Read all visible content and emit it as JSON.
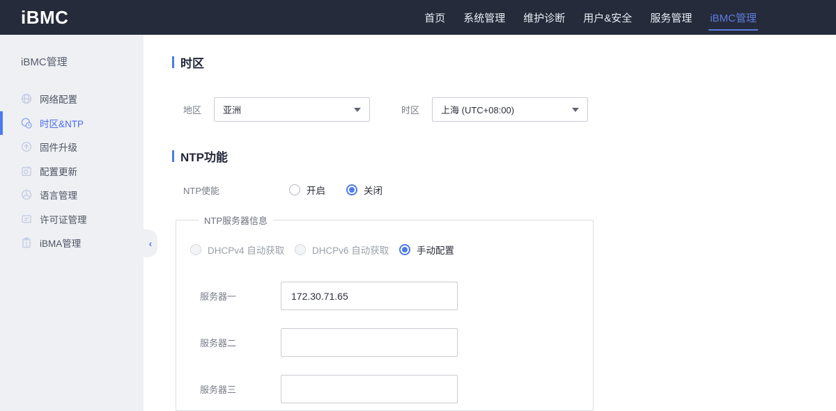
{
  "accent": "#4c7af0",
  "header": {
    "logo": "iBMC",
    "nav": [
      {
        "label": "首页",
        "active": false
      },
      {
        "label": "系统管理",
        "active": false
      },
      {
        "label": "维护诊断",
        "active": false
      },
      {
        "label": "用户&安全",
        "active": false
      },
      {
        "label": "服务管理",
        "active": false
      },
      {
        "label": "iBMC管理",
        "active": true
      }
    ]
  },
  "sidebar": {
    "title": "iBMC管理",
    "items": [
      {
        "label": "网络配置",
        "icon": "globe-icon",
        "active": false
      },
      {
        "label": "时区&NTP",
        "icon": "timezone-clock-icon",
        "active": true
      },
      {
        "label": "固件升级",
        "icon": "firmware-upload-icon",
        "active": false
      },
      {
        "label": "配置更新",
        "icon": "config-update-icon",
        "active": false
      },
      {
        "label": "语言管理",
        "icon": "language-icon",
        "active": false
      },
      {
        "label": "许可证管理",
        "icon": "license-icon",
        "active": false
      },
      {
        "label": "iBMA管理",
        "icon": "clipboard-icon",
        "active": false
      }
    ],
    "collapse_icon": "‹"
  },
  "main": {
    "timezone_section": {
      "title": "时区",
      "region_label": "地区",
      "region_value": "亚洲",
      "timezone_label": "时区",
      "timezone_value": "上海 (UTC+08:00)"
    },
    "ntp_section": {
      "title": "NTP功能",
      "enable_label": "NTP使能",
      "enable_options": [
        {
          "label": "开启",
          "checked": false
        },
        {
          "label": "关闭",
          "checked": true
        }
      ],
      "server_group": {
        "legend": "NTP服务器信息",
        "mode_options": [
          {
            "label": "DHCPv4 自动获取",
            "checked": false,
            "disabled": true
          },
          {
            "label": "DHCPv6 自动获取",
            "checked": false,
            "disabled": true
          },
          {
            "label": "手动配置",
            "checked": true,
            "disabled": false
          }
        ],
        "servers": [
          {
            "label": "服务器一",
            "value": "172.30.71.65"
          },
          {
            "label": "服务器二",
            "value": ""
          },
          {
            "label": "服务器三",
            "value": ""
          }
        ]
      }
    }
  }
}
